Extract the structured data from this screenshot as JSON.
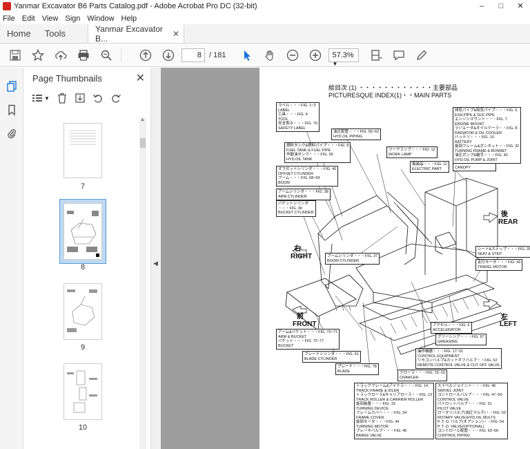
{
  "window": {
    "title": "Yanmar Excavator B6  Parts Catalog.pdf - Adobe Acrobat Pro DC (32-bit)"
  },
  "menu": [
    "File",
    "Edit",
    "View",
    "Sign",
    "Window",
    "Help"
  ],
  "tabs": {
    "home": "Home",
    "tools": "Tools",
    "doc": "Yanmar Excavator B..."
  },
  "toolbar": {
    "page_current": "8",
    "page_total": "/ 181",
    "zoom": "57.3%"
  },
  "panel": {
    "title": "Page Thumbnails",
    "thumbnails": [
      {
        "label": "7"
      },
      {
        "label": "8"
      },
      {
        "label": "9"
      },
      {
        "label": "10"
      }
    ]
  },
  "document": {
    "title_jp": "絵目次 (1) ・・・・・・・・・・・・主要部品",
    "title_en": "PICTURESQUE INDEX(1)・・MAIN PARTS",
    "direction_right_jp": "右",
    "direction_right": "RIGHT",
    "direction_front_jp": "前",
    "direction_front": "FRONT",
    "direction_rear_jp": "後",
    "direction_rear": "REAR",
    "direction_left_jp": "左",
    "direction_left": "LEFT",
    "labels": [
      "ラベル・・・FIG. 1~3\nLABEL\n工具・・・FIG. 4\nTOOL\n安全表示・・・FIG. 79\nSAFETY LABEL",
      "油圧配管・・・FIG. 56~62\nHYD.OIL PIPING",
      "燃料タンク&燃料パイプ・・・FIG. 9\nFUEL TANK & FUEL PIPE\n作動油タンク・・・FIG. 55\nHYD.OIL TANK",
      "ワークランプ・・・FIG. 12\nWORK LAMP",
      "電装品・・・FIG. 11\nELECTRIC PART",
      "キャノピ・・・FIG. 36\nCANOPY",
      "オフセットシリンダ・・・FIG. 40\nOFFSET CYLINDER\nブーム・・・FIG. 68~69\nBOOM",
      "アームシリンダ・・・FIG. 38\nARM CYLINDER",
      "バケットシリンダ\n・・・FIG. 39\nBUCKET CYLINDER",
      "排気パイプ&吸気パイプ・・・FIG. 5\nEXH.PIPE & SUC.PIPE\nエンジンマウント・・・FIG. 7\nENGINE MOUNT\nラジエータ&オイルクーラ・・FIG. 8\nRADIATOR & OIL COOLER\nバッテリ・・・FIG. 10\nBATTERY\n旋回フレーム&ボンネット・・FIG. 32\nTURNING FRAME & BONNET\n油圧ポンプ&継手・・・FIG. 42\nHYD.OIL PUMP & JOINT",
      "シート&ステップ・・・FIG. 35\nSEAT & STEP",
      "走行モータ・・・FIG. 43\nTRAVEL MOTOR",
      "ブームシリンダ・・・FIG. 37\nBOOM CYLINDER",
      "アクセル・・・FIG. 6\nACCELERATOR",
      "グリーシング・・・FIG. 67\nGREASING",
      "アーム&バケット・・・FIG. 70~71\nARM & BUCKET\nバケット・・・FIG. 72~77\nBUCKET",
      "操作機器・・・FIG. 17~31\nCONTROL EQUIPMENT\nリモコンバルブ&カットオフバルブ・・FIG. 52\nREMOTE CONTROL VALVE & CUT OFF VALVE",
      "ブレードシリンダ・・・FIG. 41\nBLADE CYLINDER",
      "ブレード・・・FIG. 78\nBLADE",
      "クローラ・・・FIG. 15~16\nCRAWLER",
      "トラックフレーム&アイドラ・・・FIG. 14\nTRACK FRAME & IDLER\nトラックローラ&キャリアローラ・・FIG. 13\nTRACK ROLLER & CARRIER ROLLER\n旋回装置・・・FIG. 33\nTURNING DEVICE\nフレームカバー・・・FIG. 34\nFRAME COVER\n旋回モータ・・・FIG. 44\nTURNING MOTOR\nブレーキバルブ・・・FIG. 45\nBRAKE VALVE",
      "スイベルジョイント・・・FIG. 46\nSWIVEL JOINT\nコントロールバルブ・・・FIG. 47~50\nCONTROL VALVE\nパイロットバルブ・・・FIG. 51\nPILOT VALVE\nロータリバルブ(油圧マルチ)・・FIG. 53\nROTARY VALVE(HYD.OIL MULTI)\nP. T. O. バルブ(オプション)・・FIG. 54\nP. T. O. VALVE(OPTIONAL)\nコントロール配管・・・FIG. 63~66\nCONTROL PIPING"
    ]
  }
}
